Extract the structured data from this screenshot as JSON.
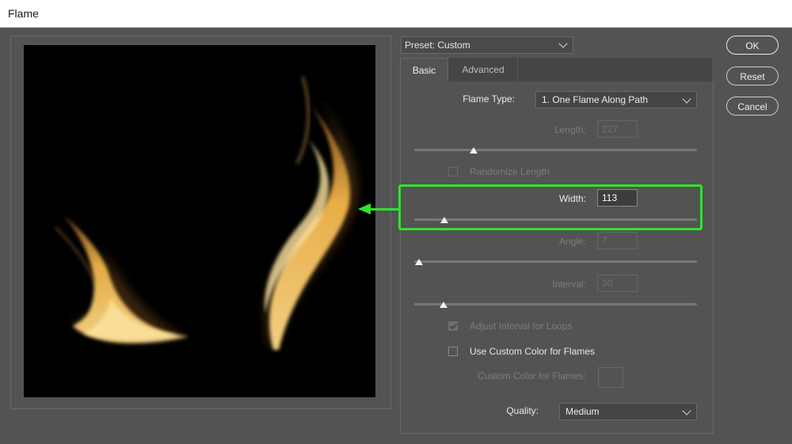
{
  "window": {
    "title": "Flame"
  },
  "preset": {
    "label": "Preset: Custom"
  },
  "tabs": {
    "basic": "Basic",
    "advanced": "Advanced"
  },
  "flame_type": {
    "label": "Flame Type:",
    "value": "1. One Flame Along Path"
  },
  "length": {
    "label": "Length:",
    "value": "227",
    "slider_fraction": 0.21
  },
  "randomize_length": {
    "label": "Randomize Length",
    "checked": false
  },
  "width": {
    "label": "Width:",
    "value": "113",
    "slider_fraction": 0.1
  },
  "angle": {
    "label": "Angle:",
    "value": "7",
    "slider_fraction": 0.02
  },
  "interval": {
    "label": "Interval:",
    "value": "30",
    "slider_fraction": 0.1
  },
  "adjust_interval": {
    "label": "Adjust Interval for Loops",
    "checked": true
  },
  "custom_color": {
    "label": "Use Custom Color for Flames",
    "checked": false
  },
  "custom_color_field": {
    "label": "Custom Color for Flames:"
  },
  "quality": {
    "label": "Quality:",
    "value": "Medium"
  },
  "buttons": {
    "ok": "OK",
    "reset": "Reset",
    "cancel": "Cancel"
  },
  "colors": {
    "highlight": "#2ee32e",
    "flame": "#f2b54a"
  }
}
